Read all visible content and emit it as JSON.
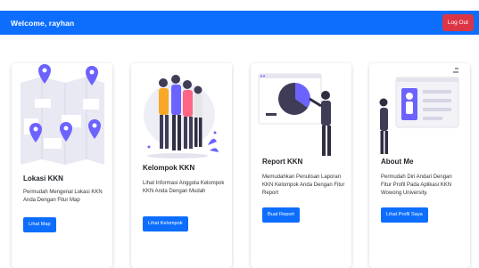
{
  "navbar": {
    "welcome": "Welcome, rayhan",
    "logout_label": "Log Out"
  },
  "colors": {
    "primary": "#0d6efd",
    "danger": "#dc3545",
    "illustration_accent": "#6c63ff",
    "illustration_dark": "#3f3d56"
  },
  "cards": [
    {
      "title": "Lokasi KKN",
      "text": "Permudah Mengenal Lokasi KKN Anda Dengan Fitur Map",
      "button": "Lihat Map",
      "illustration": "map-pins-illustration"
    },
    {
      "title": "Kelompok KKN",
      "text": "Lihat Informasi Anggota Kelompok KKN Anda Dengan Mudah",
      "button": "Lihat Kelompok",
      "illustration": "group-people-illustration"
    },
    {
      "title": "Report KKN",
      "text": "Memudahkan Penulisan Laporan KKN Kelompok Anda Dengan Fitur Report",
      "button": "Buat Report",
      "illustration": "pie-chart-presentation-illustration"
    },
    {
      "title": "About Me",
      "text": "Permudah Diri Andari Dengan Fitur Profil Pada Aplikasi KKN Wowong University.",
      "button": "Lihat Profil Saya",
      "illustration": "profile-card-illustration"
    }
  ]
}
